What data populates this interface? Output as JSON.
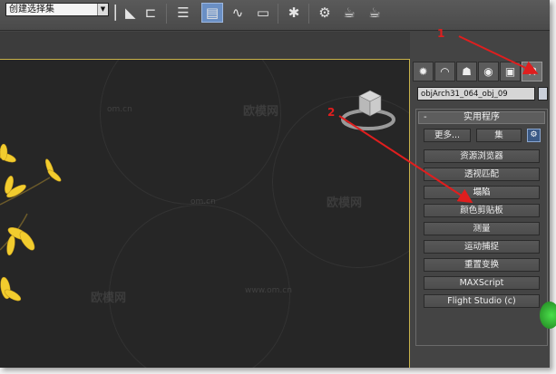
{
  "toolbar": {
    "selection_set": "创建选择集",
    "icons": [
      "mirror-icon",
      "align-icon",
      "layer-manager-icon",
      "graphite-ribbon-icon",
      "curve-editor-icon",
      "schematic-view-icon",
      "material-editor-icon",
      "render-setup-icon",
      "rendered-frame-icon",
      "render-icon"
    ]
  },
  "command_panel": {
    "tabs": [
      "create-tab",
      "modify-tab",
      "hierarchy-tab",
      "motion-tab",
      "display-tab",
      "utilities-tab"
    ],
    "object_name": "objArch31_064_obj_09",
    "rollout_title": "实用程序",
    "rollout_collapse": "-",
    "more_button": "更多...",
    "sets_button": "集",
    "utilities": [
      "资源浏览器",
      "透视匹配",
      "塌陷",
      "颜色剪贴板",
      "测量",
      "运动捕捉",
      "重置变换",
      "MAXScript",
      "Flight Studio (c)"
    ]
  },
  "watermarks": {
    "brand": "欧模网",
    "site": "om.cn",
    "site_full": "www.om.cn"
  },
  "annotations": [
    "1",
    "2"
  ],
  "colors": {
    "annotation_red": "#e01e1e",
    "viewport_border": "#c8b24a",
    "flower_yellow": "#f2cc2e"
  }
}
